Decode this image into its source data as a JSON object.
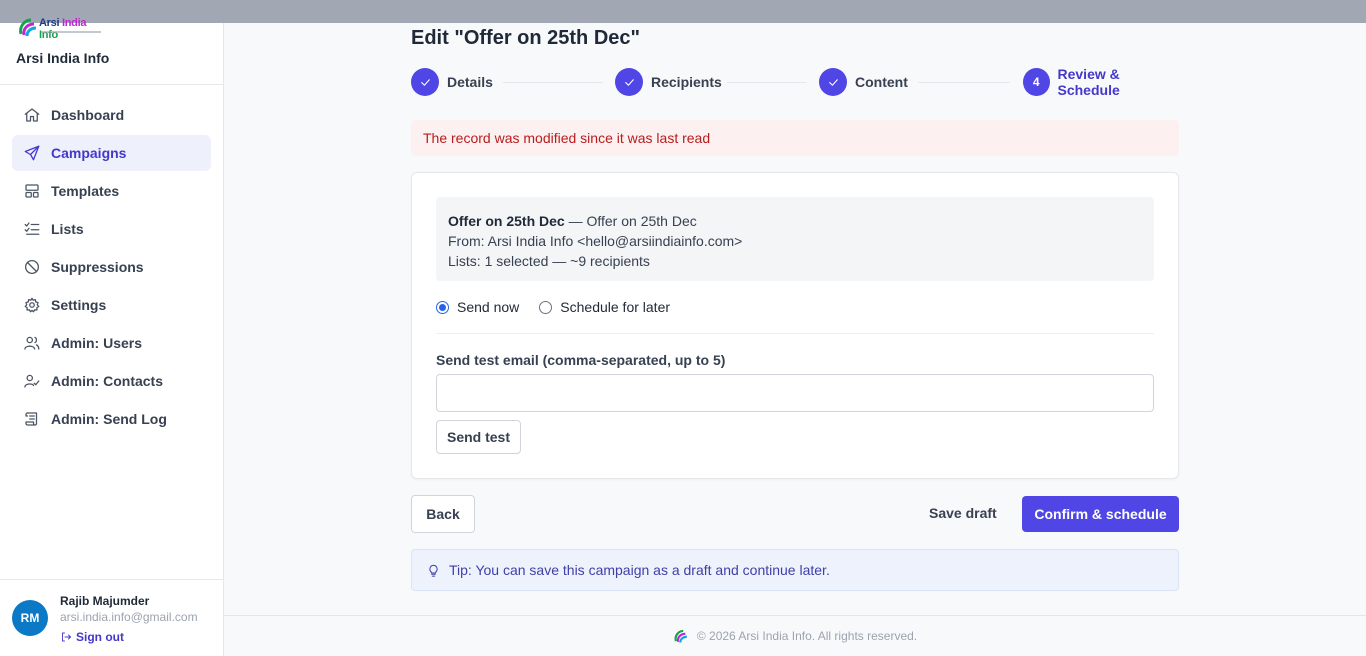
{
  "brand": {
    "logo_words": [
      "Arsi",
      "India",
      "Info"
    ],
    "name": "Arsi India Info"
  },
  "sidebar": {
    "items": [
      {
        "label": "Dashboard",
        "icon": "home-icon"
      },
      {
        "label": "Campaigns",
        "icon": "send-icon",
        "active": true
      },
      {
        "label": "Templates",
        "icon": "layout-icon"
      },
      {
        "label": "Lists",
        "icon": "list-check-icon"
      },
      {
        "label": "Suppressions",
        "icon": "ban-icon"
      },
      {
        "label": "Settings",
        "icon": "gear-icon"
      },
      {
        "label": "Admin: Users",
        "icon": "users-icon"
      },
      {
        "label": "Admin: Contacts",
        "icon": "user-check-icon"
      },
      {
        "label": "Admin: Send Log",
        "icon": "scroll-icon"
      }
    ]
  },
  "user": {
    "initials": "RM",
    "name": "Rajib Majumder",
    "email": "arsi.india.info@gmail.com",
    "signout": "Sign out"
  },
  "page": {
    "title": "Edit \"Offer on 25th Dec\""
  },
  "steps": [
    {
      "label": "Details",
      "status": "done"
    },
    {
      "label": "Recipients",
      "status": "done"
    },
    {
      "label": "Content",
      "status": "done"
    },
    {
      "label": "Review & Schedule",
      "status": "current",
      "number": "4"
    }
  ],
  "alert": {
    "text": "The record was modified since it was last read"
  },
  "summary": {
    "name": "Offer on 25th Dec",
    "subject_suffix": " — Offer on 25th Dec",
    "from": "From: Arsi India Info <hello@arsiindiainfo.com>",
    "lists": "Lists: 1 selected — ~9 recipients"
  },
  "schedule": {
    "send_now": "Send now",
    "schedule_later": "Schedule for later",
    "selected": "send_now"
  },
  "test_email": {
    "label": "Send test email (comma-separated, up to 5)",
    "value": "",
    "button": "Send test"
  },
  "actions": {
    "back": "Back",
    "save_draft": "Save draft",
    "confirm": "Confirm & schedule"
  },
  "tip": {
    "text": "Tip: You can save this campaign as a draft and continue later."
  },
  "footer": {
    "text": "© 2026 Arsi India Info. All rights reserved."
  },
  "colors": {
    "accent": "#4f46e5",
    "alert_text": "#b91c1c",
    "alert_bg": "#fdf0f0",
    "tip_bg": "#eef2fc",
    "avatar": "#0b79c6"
  }
}
